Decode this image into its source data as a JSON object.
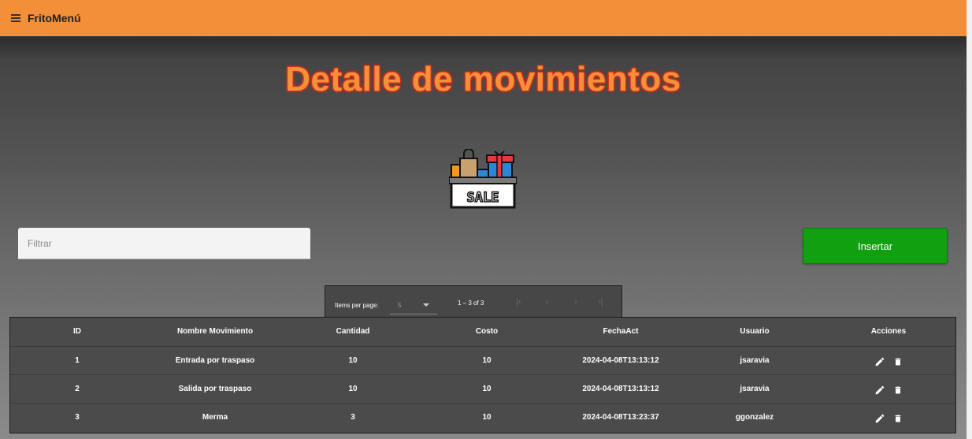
{
  "app": {
    "title": "FritoMenú"
  },
  "page": {
    "title": "Detalle de movimientos"
  },
  "filter": {
    "placeholder": "Filtrar",
    "value": ""
  },
  "insert_button": {
    "label": "Insertar"
  },
  "paginator": {
    "items_per_page_label": "Items per page:",
    "page_size": "5",
    "range": "1 – 3 of 3"
  },
  "table": {
    "columns": [
      "ID",
      "Nombre Movimiento",
      "Cantidad",
      "Costo",
      "FechaAct",
      "Usuario",
      "Acciones"
    ],
    "rows": [
      [
        "1",
        "Entrada por traspaso",
        "10",
        "10",
        "2024-04-08T13:13:12",
        "jsaravia"
      ],
      [
        "2",
        "Salida por traspaso",
        "10",
        "10",
        "2024-04-08T13:13:12",
        "jsaravia"
      ],
      [
        "3",
        "Merma",
        "3",
        "10",
        "2024-04-08T13:23:37",
        "ggonzalez"
      ]
    ]
  },
  "colors": {
    "topbar": "#f28f38",
    "title": "#f5903a",
    "insert_button": "#10a010"
  },
  "icons": [
    "menu-icon",
    "sale-icon",
    "edit-icon",
    "delete-icon",
    "first-page-icon",
    "prev-page-icon",
    "next-page-icon",
    "last-page-icon",
    "dropdown-arrow-icon"
  ]
}
